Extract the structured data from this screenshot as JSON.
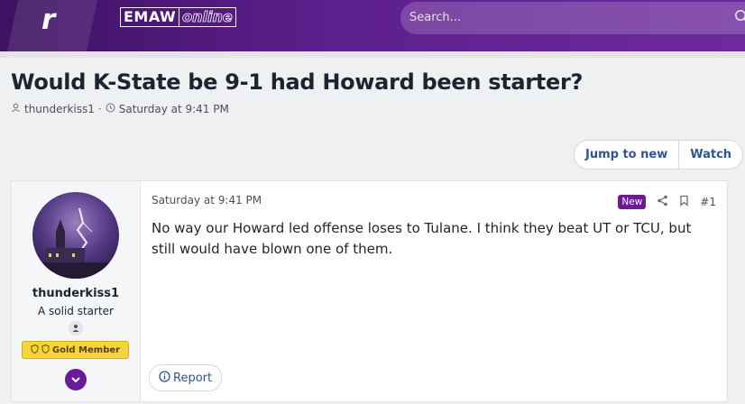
{
  "header": {
    "logo_letter": "r",
    "brand_left": "EMAW",
    "brand_right": "online",
    "search_placeholder": "Search..."
  },
  "thread": {
    "title": "Would K-State be 9-1 had Howard been starter?",
    "author": "thunderkiss1",
    "separator": "·",
    "date": "Saturday at 9:41 PM"
  },
  "thread_actions": {
    "jump_label": "Jump to new",
    "watch_label": "Watch"
  },
  "post": {
    "username": "thunderkiss1",
    "user_title": "A solid starter",
    "badge": "Gold Member",
    "date": "Saturday at 9:41 PM",
    "new_label": "New",
    "number": "#1",
    "text": "No way our Howard led offense loses to Tulane. I think they beat UT or TCU, but still would have blown one of them.",
    "report_label": "Report"
  },
  "colors": {
    "brand_purple": "#6a1b9a",
    "link_blue": "#2f5494",
    "gold": "#f6d53b"
  }
}
